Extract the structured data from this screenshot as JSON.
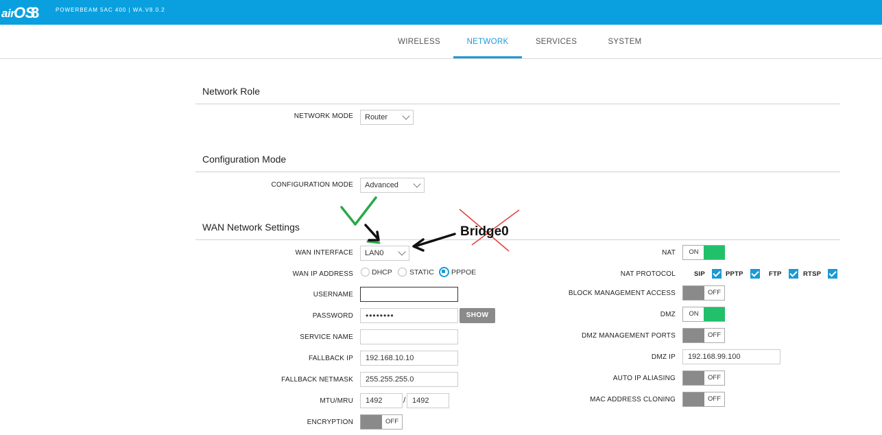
{
  "header": {
    "logo_air": "air",
    "logo_os": "OS",
    "logo_ver": "8",
    "device": "POWERBEAM 5AC 400 | WA.V8.0.2"
  },
  "tabs": [
    {
      "label": "WIRELESS",
      "active": false
    },
    {
      "label": "NETWORK",
      "active": true
    },
    {
      "label": "SERVICES",
      "active": false
    },
    {
      "label": "SYSTEM",
      "active": false
    }
  ],
  "network_role": {
    "title": "Network Role",
    "network_mode_label": "NETWORK MODE",
    "network_mode_value": "Router"
  },
  "config_mode": {
    "title": "Configuration Mode",
    "label": "CONFIGURATION MODE",
    "value": "Advanced"
  },
  "wan": {
    "title": "WAN Network Settings",
    "wan_interface_label": "WAN INTERFACE",
    "wan_interface_value": "LAN0",
    "wan_ip_label": "WAN IP ADDRESS",
    "ip_options": [
      "DHCP",
      "STATIC",
      "PPPOE"
    ],
    "ip_selected": "PPPOE",
    "username_label": "USERNAME",
    "username_value": "",
    "password_label": "PASSWORD",
    "password_value": "••••••••",
    "show_label": "SHOW",
    "service_name_label": "SERVICE NAME",
    "service_name_value": "",
    "fallback_ip_label": "FALLBACK IP",
    "fallback_ip_value": "192.168.10.10",
    "fallback_netmask_label": "FALLBACK NETMASK",
    "fallback_netmask_value": "255.255.255.0",
    "mtu_label": "MTU/MRU",
    "mtu_value": "1492",
    "mru_value": "1492",
    "mtu_sep": "/",
    "encryption_label": "ENCRYPTION",
    "encryption_state": "OFF"
  },
  "right": {
    "nat_label": "NAT",
    "nat_state": "ON",
    "nat_protocol_label": "NAT PROTOCOL",
    "protocols": [
      "SIP",
      "PPTP",
      "FTP",
      "RTSP"
    ],
    "block_mgmt_label": "BLOCK MANAGEMENT ACCESS",
    "block_mgmt_state": "OFF",
    "dmz_label": "DMZ",
    "dmz_state": "ON",
    "dmz_mgmt_label": "DMZ MANAGEMENT PORTS",
    "dmz_mgmt_state": "OFF",
    "dmz_ip_label": "DMZ IP",
    "dmz_ip_value": "192.168.99.100",
    "auto_ip_label": "AUTO IP ALIASING",
    "auto_ip_state": "OFF",
    "mac_clone_label": "MAC ADDRESS CLONING",
    "mac_clone_state": "OFF"
  },
  "annotation": {
    "text": "Bridge0",
    "check_color": "#2aa84a",
    "cross_color": "#e04040",
    "arrow_color": "#111111"
  },
  "colors": {
    "header_bg": "#0aa0e0",
    "accent": "#1a9ad6",
    "toggle_on": "#22c06a",
    "toggle_off": "#8a8a8a"
  }
}
